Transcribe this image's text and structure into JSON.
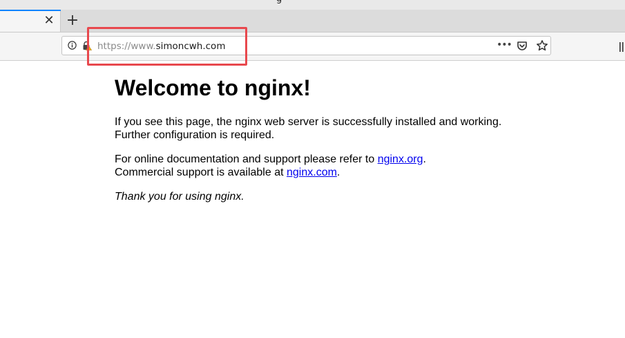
{
  "window": {
    "title_fragment": "g"
  },
  "tabs": [
    {
      "label": "",
      "close_glyph": "✕"
    }
  ],
  "new_tab_glyph": "+",
  "urlbar": {
    "scheme_prefix": "https://www.",
    "host": "simoncwh.com",
    "page_actions_glyph": "•••"
  },
  "icons": {
    "info": "info-icon",
    "lock": "lock-warning-icon",
    "pocket": "pocket-icon",
    "bookmark": "star-icon",
    "library": "library-icon"
  },
  "colors": {
    "highlight": "#e8484d",
    "link": "#0000ee",
    "tab_accent": "#0a84ff"
  },
  "page": {
    "heading": "Welcome to nginx!",
    "p1_line1": "If you see this page, the nginx web server is successfully installed and working.",
    "p1_line2": "Further configuration is required.",
    "p2_prefix": "For online documentation and support please refer to ",
    "p2_link1": "nginx.org",
    "p2_mid": ".",
    "p2_line2_prefix": "Commercial support is available at ",
    "p2_link2": "nginx.com",
    "p2_end": ".",
    "p3": "Thank you for using nginx."
  }
}
